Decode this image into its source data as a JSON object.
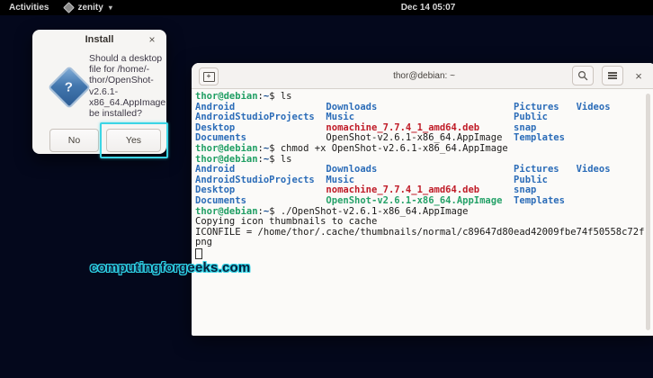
{
  "topbar": {
    "activities_label": "Activities",
    "app_name": "zenity",
    "clock": "Dec 14 05:07"
  },
  "dialog": {
    "title": "Install",
    "close_glyph": "×",
    "icon_glyph": "?",
    "message_lines": [
      "Should a desktop",
      "file for /home/-",
      "thor/OpenShot-",
      "v2.6.1-",
      "x86_64.AppImage",
      "be installed?"
    ],
    "no_label": "No",
    "yes_label": "Yes"
  },
  "terminal": {
    "title": "thor@debian: ~",
    "close_glyph": "×",
    "newtab_glyph": "+",
    "lines": [
      [
        [
          "pu",
          "thor@debian"
        ],
        [
          "t",
          ":"
        ],
        [
          "pp",
          "~"
        ],
        [
          "t",
          "$ ls"
        ]
      ],
      [
        [
          "dir",
          "Android"
        ],
        [
          "t",
          "                "
        ],
        [
          "dir",
          "Downloads"
        ],
        [
          "t",
          "                        "
        ],
        [
          "dir",
          "Pictures"
        ],
        [
          "t",
          "   "
        ],
        [
          "dir",
          "Videos"
        ]
      ],
      [
        [
          "dir",
          "AndroidStudioProjects"
        ],
        [
          "t",
          "  "
        ],
        [
          "dir",
          "Music"
        ],
        [
          "t",
          "                            "
        ],
        [
          "dir",
          "Public"
        ]
      ],
      [
        [
          "dir",
          "Desktop"
        ],
        [
          "t",
          "                "
        ],
        [
          "arc",
          "nomachine_7.7.4_1_amd64.deb"
        ],
        [
          "t",
          "      "
        ],
        [
          "dir",
          "snap"
        ]
      ],
      [
        [
          "dir",
          "Documents"
        ],
        [
          "t",
          "              "
        ],
        [
          "t",
          "OpenShot-v2.6.1-x86_64.AppImage"
        ],
        [
          "t",
          "  "
        ],
        [
          "dir",
          "Templates"
        ]
      ],
      [
        [
          "pu",
          "thor@debian"
        ],
        [
          "t",
          ":"
        ],
        [
          "pp",
          "~"
        ],
        [
          "t",
          "$ chmod +x OpenShot-v2.6.1-x86_64.AppImage"
        ]
      ],
      [
        [
          "pu",
          "thor@debian"
        ],
        [
          "t",
          ":"
        ],
        [
          "pp",
          "~"
        ],
        [
          "t",
          "$ ls"
        ]
      ],
      [
        [
          "dir",
          "Android"
        ],
        [
          "t",
          "                "
        ],
        [
          "dir",
          "Downloads"
        ],
        [
          "t",
          "                        "
        ],
        [
          "dir",
          "Pictures"
        ],
        [
          "t",
          "   "
        ],
        [
          "dir",
          "Videos"
        ]
      ],
      [
        [
          "dir",
          "AndroidStudioProjects"
        ],
        [
          "t",
          "  "
        ],
        [
          "dir",
          "Music"
        ],
        [
          "t",
          "                            "
        ],
        [
          "dir",
          "Public"
        ]
      ],
      [
        [
          "dir",
          "Desktop"
        ],
        [
          "t",
          "                "
        ],
        [
          "arc",
          "nomachine_7.7.4_1_amd64.deb"
        ],
        [
          "t",
          "      "
        ],
        [
          "dir",
          "snap"
        ]
      ],
      [
        [
          "dir",
          "Documents"
        ],
        [
          "t",
          "              "
        ],
        [
          "exe",
          "OpenShot-v2.6.1-x86_64.AppImage"
        ],
        [
          "t",
          "  "
        ],
        [
          "dir",
          "Templates"
        ]
      ],
      [
        [
          "pu",
          "thor@debian"
        ],
        [
          "t",
          ":"
        ],
        [
          "pp",
          "~"
        ],
        [
          "t",
          "$ ./OpenShot-v2.6.1-x86_64.AppImage"
        ]
      ],
      [
        [
          "t",
          "Copying icon thumbnails to cache"
        ]
      ],
      [
        [
          "t",
          "ICONFILE = /home/thor/.cache/thumbnails/normal/c89647d80ead42009fbe74f50558c72f."
        ]
      ],
      [
        [
          "t",
          "png"
        ]
      ],
      [
        [
          "cursor",
          ""
        ]
      ]
    ]
  },
  "watermark": {
    "text": "computingforgeeks.com"
  },
  "colors": {
    "highlight_cyan": "#3bd5e5",
    "prompt_green": "#1f9e63",
    "path_blue": "#12488b",
    "dir_blue": "#2b6cb8",
    "archive_red": "#c01c28",
    "exec_green": "#26a269",
    "desktop_bg": "#04081c"
  }
}
